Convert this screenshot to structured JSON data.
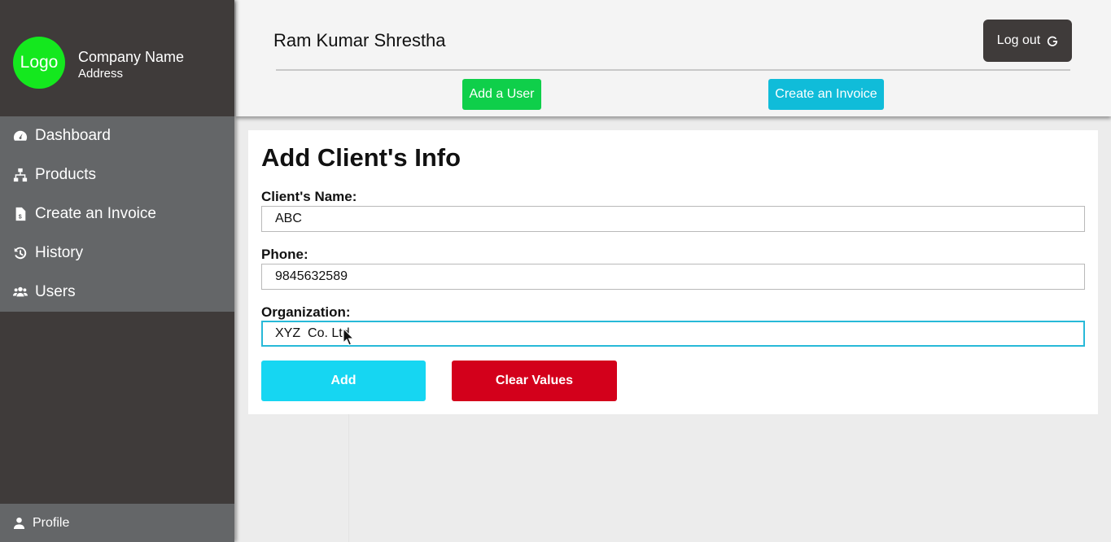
{
  "brand": {
    "logo_text": "Logo",
    "company_name": "Company Name",
    "address": "Address",
    "logo_color": "#14e81e"
  },
  "sidebar": {
    "items": [
      {
        "label": "Dashboard",
        "icon": "tachometer-icon"
      },
      {
        "label": "Products",
        "icon": "sitemap-icon"
      },
      {
        "label": "Create an Invoice",
        "icon": "file-invoice-dollar-icon"
      },
      {
        "label": "History",
        "icon": "history-icon"
      },
      {
        "label": "Users",
        "icon": "users-icon"
      }
    ],
    "profile_label": "Profile"
  },
  "header": {
    "user_name": "Ram Kumar Shrestha",
    "logout_label": "Log out",
    "add_user_label": "Add a User",
    "create_invoice_label": "Create an Invoice"
  },
  "form": {
    "title": "Add Client's Info",
    "client_name_label": "Client's Name:",
    "client_name_value": "ABC",
    "phone_label": "Phone:",
    "phone_value": "9845632589",
    "organization_label": "Organization:",
    "organization_value": "XYZ  Co. Ltd",
    "add_label": "Add",
    "clear_label": "Clear Values"
  },
  "colors": {
    "sidebar_bg": "#3f3b3a",
    "nav_bg": "#646668",
    "add_user_btn": "#0fcf4a",
    "create_invoice_btn": "#10bcd9",
    "add_btn": "#16d6f2",
    "clear_btn": "#d3001b"
  }
}
